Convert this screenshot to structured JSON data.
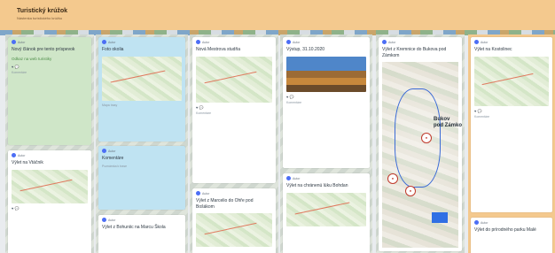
{
  "header": {
    "title": "Turistický krúžok",
    "subtitle": "Nástenka turistického krúžku"
  },
  "columns": [
    {
      "cards": [
        {
          "author": "Autor",
          "title": "Nový článok pre tento príspevok",
          "link": "Odkaz na web turistiky",
          "icons": "♥ 💬",
          "meta": "Komentáre"
        },
        {
          "author": "Autor",
          "title": "Výlet na Vtáčnik",
          "icons": "♥ 💬"
        }
      ]
    },
    {
      "cards": [
        {
          "author": "Autor",
          "title": "Foto okolia",
          "meta": "Mapa trasy"
        },
        {
          "author": "Autor",
          "title": "Komentáre",
          "meta": "Poznámka k trase"
        },
        {
          "author": "Autor",
          "title": "Výlet z Bohuniic na Marcu Škola"
        }
      ]
    },
    {
      "cards": [
        {
          "author": "Autor",
          "title": "Nová Mestrova studňa",
          "icons": "♥ 💬",
          "meta": "Komentáre"
        },
        {
          "author": "Autor",
          "title": "Výlet z Marcelio do Ohře pod Bošákom"
        }
      ]
    },
    {
      "cards": [
        {
          "author": "Autor",
          "title": "Výstup, 31.10.2020",
          "icons": "♥ 💬",
          "meta": "Komentáre"
        },
        {
          "author": "Autor",
          "title": "Výlet na chránenú lúku Bohdan"
        }
      ]
    },
    {
      "cards": [
        {
          "author": "Autor",
          "title": "Výlet z Kremnice do Bukova pod Zámkom"
        }
      ],
      "map_label": "Bukov\npod Zámkom"
    },
    {
      "cards": [
        {
          "author": "Autor",
          "title": "Výlet na Kostolinec",
          "icons": "♥ 💬",
          "meta": "Komentáre"
        },
        {
          "author": "Autor",
          "title": "Výlet do prírodného parku Malé"
        }
      ]
    }
  ]
}
